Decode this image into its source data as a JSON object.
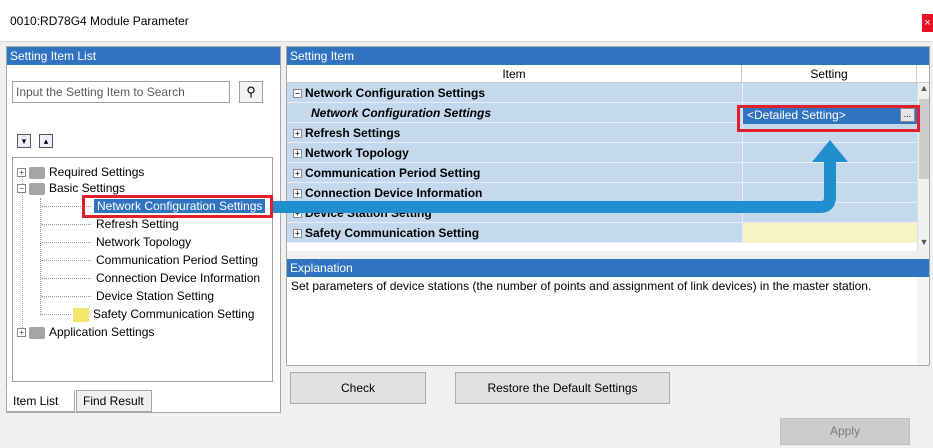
{
  "window": {
    "title": "0010:RD78G4 Module Parameter",
    "close_glyph": "×"
  },
  "left_panel": {
    "header": "Setting Item List",
    "search_placeholder": "Input the Setting Item to Search",
    "tree": [
      {
        "label": "Required Settings"
      },
      {
        "label": "Basic Settings"
      },
      {
        "label": "Network Configuration Settings"
      },
      {
        "label": "Refresh Setting"
      },
      {
        "label": "Network Topology"
      },
      {
        "label": "Communication Period Setting"
      },
      {
        "label": "Connection Device Information"
      },
      {
        "label": "Device Station Setting"
      },
      {
        "label": "Safety Communication Setting"
      },
      {
        "label": "Application Settings"
      }
    ],
    "tabs": [
      "Item List",
      "Find Result"
    ]
  },
  "right_panel": {
    "header": "Setting Item",
    "columns": {
      "item": "Item",
      "setting": "Setting"
    },
    "rows": [
      {
        "label": "Network Configuration Settings"
      },
      {
        "label": "Network Configuration Settings"
      },
      {
        "label": "Refresh Settings"
      },
      {
        "label": "Network Topology"
      },
      {
        "label": "Communication Period Setting"
      },
      {
        "label": "Connection Device Information"
      },
      {
        "label": "Device Station Setting"
      },
      {
        "label": "Safety Communication Setting"
      }
    ],
    "detail_value": "<Detailed Setting>",
    "detail_button": "...",
    "explanation_header": "Explanation",
    "explanation_text": "Set parameters of device stations (the number of points and assignment of link devices) in the master station."
  },
  "buttons": {
    "check": "Check",
    "restore": "Restore the Default Settings",
    "apply": "Apply"
  },
  "colors": {
    "accent": "#2f73c1",
    "highlight": "#e0202a",
    "row": "#c5d9ee"
  }
}
